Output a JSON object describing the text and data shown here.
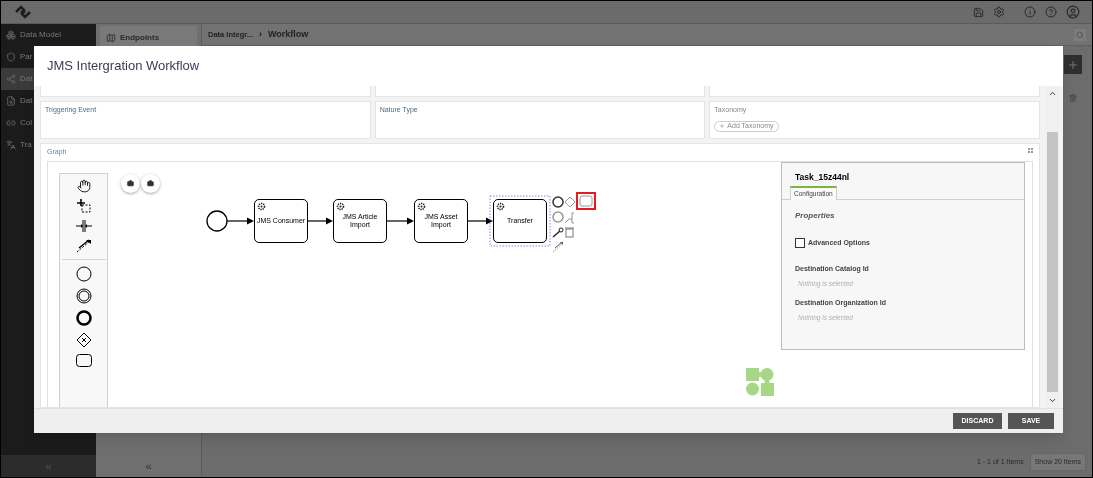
{
  "app": {
    "sidebar": [
      {
        "label": "Data Model",
        "selected": false
      },
      {
        "label": "Par",
        "selected": false
      },
      {
        "label": "Dat",
        "selected": true
      },
      {
        "label": "Dat",
        "selected": false
      },
      {
        "label": "Col",
        "selected": false
      },
      {
        "label": "Tra",
        "selected": false
      }
    ],
    "collapse": "«",
    "subnav": {
      "label": "Endpoints",
      "collapse": "«"
    },
    "breadcrumb": [
      "Data Integr...",
      "Workflow"
    ],
    "breadcrumb_separator": "›",
    "pagination": "1 - 1 of 1 Items",
    "page_size": "Show 20 Items"
  },
  "modal": {
    "title": "JMS Intergration Workflow",
    "fields": [
      {
        "label": "Triggering Event"
      },
      {
        "label": "Nature Type"
      },
      {
        "label": "Taxonomy",
        "button": "Add Taxonomy"
      }
    ],
    "graph": {
      "label": "Graph",
      "nodes": [
        {
          "label": "JMS Consumer",
          "selected": false
        },
        {
          "label": "JMS Article Import",
          "selected": false
        },
        {
          "label": "JMS Asset Import",
          "selected": false
        },
        {
          "label": "Transfer",
          "selected": true
        }
      ],
      "properties": {
        "title": "Task_15z44nl",
        "tabs": [
          {
            "label": "Configuration",
            "selected": true
          }
        ],
        "heading": "Properties",
        "options": [
          {
            "label": "Advanced Options",
            "checked": false
          }
        ],
        "fields": [
          {
            "label": "Destination Catalog Id",
            "placeholder": "Nothing is selected"
          },
          {
            "label": "Destination Organization Id",
            "placeholder": "Nothing is selected"
          }
        ]
      }
    },
    "buttons": [
      "DISCARD",
      "SAVE"
    ]
  }
}
